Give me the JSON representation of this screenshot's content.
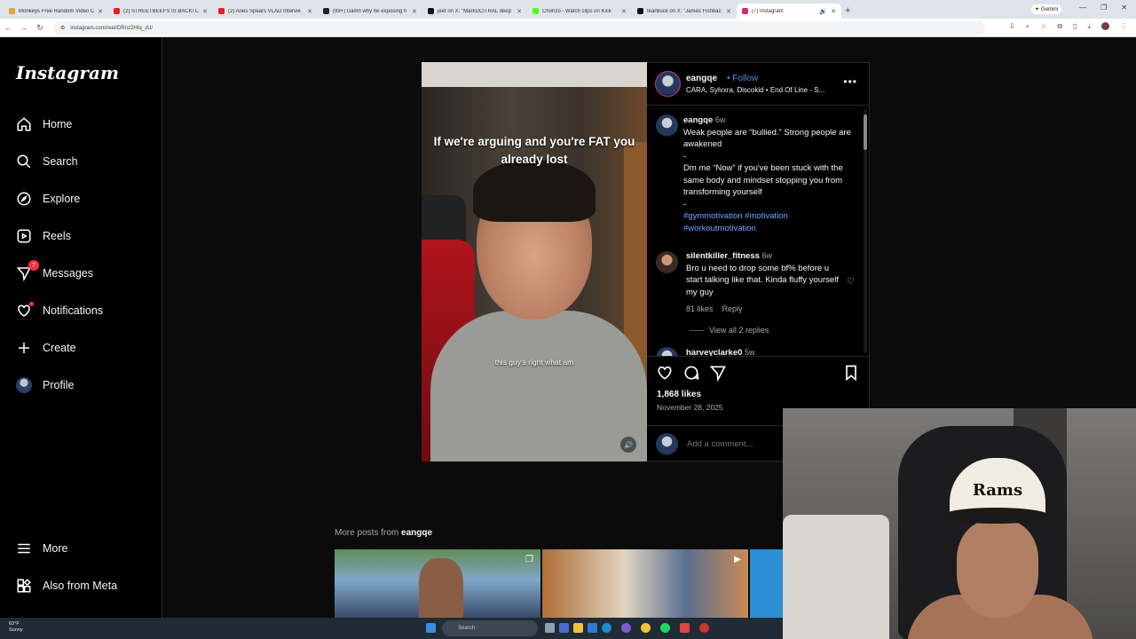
{
  "browser": {
    "tabs": [
      {
        "title": "Monkeys Free Random Video Ch",
        "color": "#e8a33c"
      },
      {
        "title": "(2) STREETBEEFS IS BACK! Last",
        "color": "#e02020"
      },
      {
        "title": "(2) Aries Spears VLAD Intervie",
        "color": "#e02020"
      },
      {
        "title": "(99+) Damn why he exposing h",
        "color": "#222222"
      },
      {
        "title": "jeet on X: \"MarkDCITRAL deep",
        "color": "#111111"
      },
      {
        "title": "Chorizo - Watch clips on Kick",
        "color": "#53fc18"
      },
      {
        "title": "fearBuck on X: \"James Fishbac",
        "color": "#111111"
      },
      {
        "title": "(7) Instagram",
        "color": "#d62976"
      }
    ],
    "gemini_label": "Gemini",
    "url": "instagram.com/reel/DRnz2HIq_zU/"
  },
  "sidebar": {
    "logo": "Instagram",
    "items": [
      {
        "label": "Home",
        "icon": "home-icon"
      },
      {
        "label": "Search",
        "icon": "search-icon"
      },
      {
        "label": "Explore",
        "icon": "compass-icon"
      },
      {
        "label": "Reels",
        "icon": "reels-icon"
      },
      {
        "label": "Messages",
        "icon": "messenger-icon",
        "badge": "7"
      },
      {
        "label": "Notifications",
        "icon": "heart-icon"
      },
      {
        "label": "Create",
        "icon": "plus-icon"
      },
      {
        "label": "Profile",
        "icon": "avatar"
      }
    ],
    "bottom": [
      {
        "label": "More",
        "icon": "menu-icon"
      },
      {
        "label": "Also from Meta",
        "icon": "meta-grid-icon"
      }
    ]
  },
  "post": {
    "video_caption": "If we're arguing and you're FAT you already lost",
    "video_subtitle": "this guy's right what am",
    "username": "eangqe",
    "follow": "• Follow",
    "audio": "CARA, Sylvxra, Discokid • End Of Line - S...",
    "caption": {
      "username": "eangqe",
      "time": "6w",
      "line1": "Weak people are “bullied.” Strong people are awakened",
      "dash1": "-",
      "line2": "Dm me “Now” if you've been stuck with the same body and mindset stopping you from transforming yourself",
      "dash2": "-",
      "hashtags": "#gymmotivation #motivation #workoutmotivation"
    },
    "comment1": {
      "username": "silentkiller_fitness",
      "time": "6w",
      "text": "Bro u need to drop some bf% before u start talking like that. Kinda fluffy yourself my guy",
      "likes": "81 likes",
      "reply": "Reply",
      "view_replies": "View all 2 replies"
    },
    "comment2": {
      "username": "harveyclarke0",
      "time": "5w"
    },
    "likes": "1,868 likes",
    "date": "November 28, 2025",
    "add_comment_placeholder": "Add a comment..."
  },
  "more_posts": {
    "prefix": "More posts from",
    "username": "eangqe"
  },
  "taskbar": {
    "temp": "63°F",
    "condition": "Sunny",
    "search_placeholder": "Search"
  },
  "webcam": {
    "cap_text": "Rams"
  }
}
